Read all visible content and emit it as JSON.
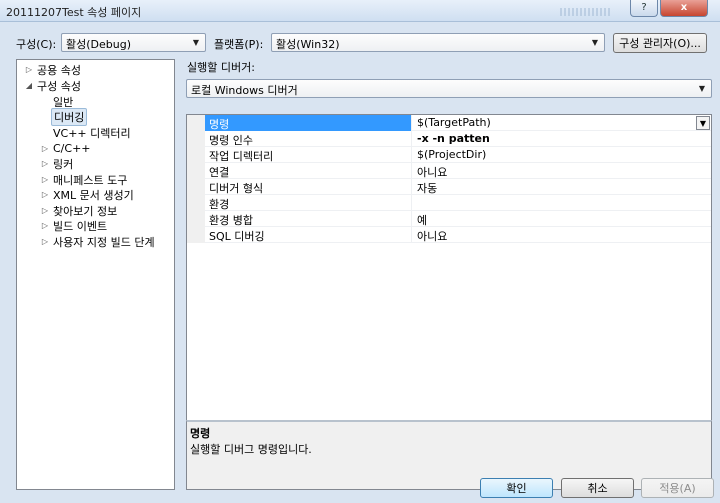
{
  "window": {
    "title": "20111207Test 속성 페이지",
    "help_button": "?",
    "close_button": "x"
  },
  "config": {
    "label": "구성(C):",
    "value": "활성(Debug)",
    "platform_label": "플랫폼(P):",
    "platform_value": "활성(Win32)",
    "manager_button": "구성 관리자(O)..."
  },
  "tree": {
    "items": [
      {
        "label": "공용 속성",
        "expander": "▷",
        "selected": false
      },
      {
        "label": "구성 속성",
        "expander": "◢",
        "selected": false
      },
      {
        "label": "일반",
        "expander": "",
        "selected": false
      },
      {
        "label": "디버깅",
        "expander": "",
        "selected": true
      },
      {
        "label": "VC++ 디렉터리",
        "expander": "",
        "selected": false
      },
      {
        "label": "C/C++",
        "expander": "▷",
        "selected": false
      },
      {
        "label": "링커",
        "expander": "▷",
        "selected": false
      },
      {
        "label": "매니페스트 도구",
        "expander": "▷",
        "selected": false
      },
      {
        "label": "XML 문서 생성기",
        "expander": "▷",
        "selected": false
      },
      {
        "label": "찾아보기 정보",
        "expander": "▷",
        "selected": false
      },
      {
        "label": "빌드 이벤트",
        "expander": "▷",
        "selected": false
      },
      {
        "label": "사용자 지정 빌드 단계",
        "expander": "▷",
        "selected": false
      }
    ]
  },
  "debugger": {
    "label": "실행할 디버거:",
    "value": "로컬 Windows 디버거"
  },
  "properties": [
    {
      "name": "명령",
      "value": "$(TargetPath)",
      "bold": false,
      "selected": true
    },
    {
      "name": "명령 인수",
      "value": "-x -n patten",
      "bold": true,
      "selected": false
    },
    {
      "name": "작업 디렉터리",
      "value": "$(ProjectDir)",
      "bold": false,
      "selected": false
    },
    {
      "name": "연결",
      "value": "아니요",
      "bold": false,
      "selected": false
    },
    {
      "name": "디버거 형식",
      "value": "자동",
      "bold": false,
      "selected": false
    },
    {
      "name": "환경",
      "value": "",
      "bold": false,
      "selected": false
    },
    {
      "name": "환경 병합",
      "value": "예",
      "bold": false,
      "selected": false
    },
    {
      "name": "SQL 디버깅",
      "value": "아니요",
      "bold": false,
      "selected": false
    }
  ],
  "description": {
    "title": "명령",
    "text": "실행할 디버그 명령입니다."
  },
  "buttons": {
    "ok": "확인",
    "cancel": "취소",
    "apply": "적용(A)"
  },
  "icons": {
    "dropdown": "▼"
  },
  "colors": {
    "selection": "#3399ff",
    "tree_selection": "#dbe8f5"
  }
}
